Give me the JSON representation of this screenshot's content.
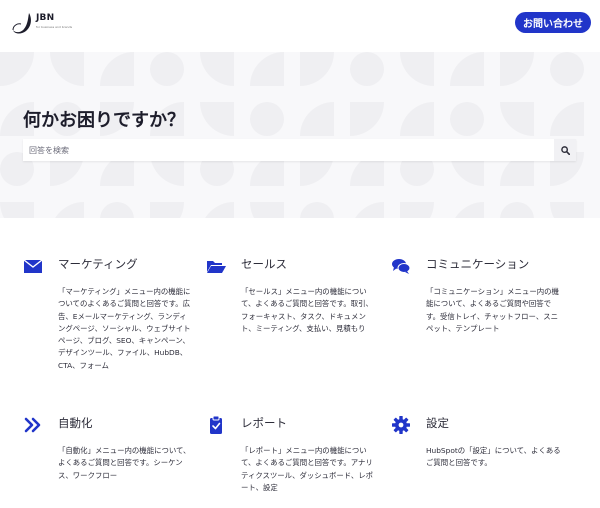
{
  "header": {
    "logo_text": "JBN",
    "logo_subtext": "for business and brands",
    "contact_button": "お問い合わせ"
  },
  "hero": {
    "title": "何かお困りですか？",
    "search_placeholder": "回答を検索"
  },
  "categories": [
    {
      "icon": "envelope-icon",
      "title": "マーケティング",
      "description": "「マーケティング」メニュー内の機能についてのよくあるご質問と回答です。広告、Eメールマーケティング、ランディングページ、ソーシャル、ウェブサイトページ、ブログ、SEO、キャンペーン、デザインツール、ファイル、HubDB、CTA、フォーム"
    },
    {
      "icon": "folder-open-icon",
      "title": "セールス",
      "description": "「セールス」メニュー内の機能について、よくあるご質問と回答です。取引、フォーキャスト、タスク、ドキュメント、ミーティング、支払い、見積もり"
    },
    {
      "icon": "chat-bubbles-icon",
      "title": "コミュニケーション",
      "description": "「コミュニケーション」メニュー内の機能について、よくあるご質問や回答です。受信トレイ、チャットフロー、スニペット、テンプレート"
    },
    {
      "icon": "double-chevron-right-icon",
      "title": "自動化",
      "description": "「自動化」メニュー内の機能について、よくあるご質問と回答です。シーケンス、ワークフロー"
    },
    {
      "icon": "clipboard-icon",
      "title": "レポート",
      "description": "「レポート」メニュー内の機能について、よくあるご質問と回答です。アナリティクスツール、ダッシュボード、レポート、設定"
    },
    {
      "icon": "gear-icon",
      "title": "設定",
      "description": "HubSpotの「設定」について、よくあるご質問と回答です。"
    }
  ],
  "colors": {
    "accent": "#2135c9",
    "hero_bg": "#f8f8fa",
    "hero_pattern": "#efeff2"
  }
}
